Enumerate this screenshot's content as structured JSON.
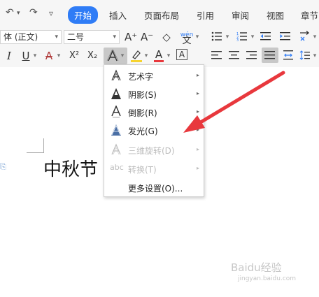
{
  "tabs": [
    {
      "label": "开始",
      "active": true
    },
    {
      "label": "插入"
    },
    {
      "label": "页面布局"
    },
    {
      "label": "引用"
    },
    {
      "label": "审阅"
    },
    {
      "label": "视图"
    },
    {
      "label": "章节"
    }
  ],
  "quick_access": {
    "undo": "↶",
    "undo_dropdown": "▾",
    "redo": "↷",
    "customize": "▿"
  },
  "font": {
    "name_value": "体 (正文)",
    "size_value": "二号"
  },
  "font_tools": {
    "grow": "A⁺",
    "shrink": "A⁻",
    "clear": "◇",
    "pinyin": "wén"
  },
  "format_tools": {
    "italic": "I",
    "underline": "U",
    "strike": "A",
    "superscript": "X²",
    "subscript": "X₂",
    "effects": "A",
    "highlight": "✎",
    "font_color": "A",
    "char_border": "A"
  },
  "menu": {
    "items": [
      {
        "label": "艺术字",
        "icon": "art-text-icon",
        "has_submenu": true,
        "disabled": false
      },
      {
        "label": "阴影(S)",
        "icon": "shadow-icon",
        "has_submenu": true,
        "disabled": false
      },
      {
        "label": "倒影(R)",
        "icon": "reflection-icon",
        "has_submenu": true,
        "disabled": false
      },
      {
        "label": "发光(G)",
        "icon": "glow-icon",
        "has_submenu": true,
        "disabled": false
      },
      {
        "label": "三维旋转(D)",
        "icon": "3d-rotation-icon",
        "has_submenu": true,
        "disabled": true
      },
      {
        "label": "转换(T)",
        "icon": "transform-icon",
        "icon_text": "abc",
        "has_submenu": true,
        "disabled": true
      },
      {
        "label": "更多设置(O)...",
        "icon": "",
        "has_submenu": false,
        "disabled": false
      }
    ],
    "submenu_glyph": "▸"
  },
  "document": {
    "text": "中秋节"
  },
  "watermark": {
    "text": "Baidu经验",
    "url": "jingyan.baidu.com"
  },
  "colors": {
    "accent": "#2f7cf6",
    "arrow": "#e8383d",
    "highlight_bar": "#f6d330",
    "font_color_bar": "#e8383d"
  }
}
